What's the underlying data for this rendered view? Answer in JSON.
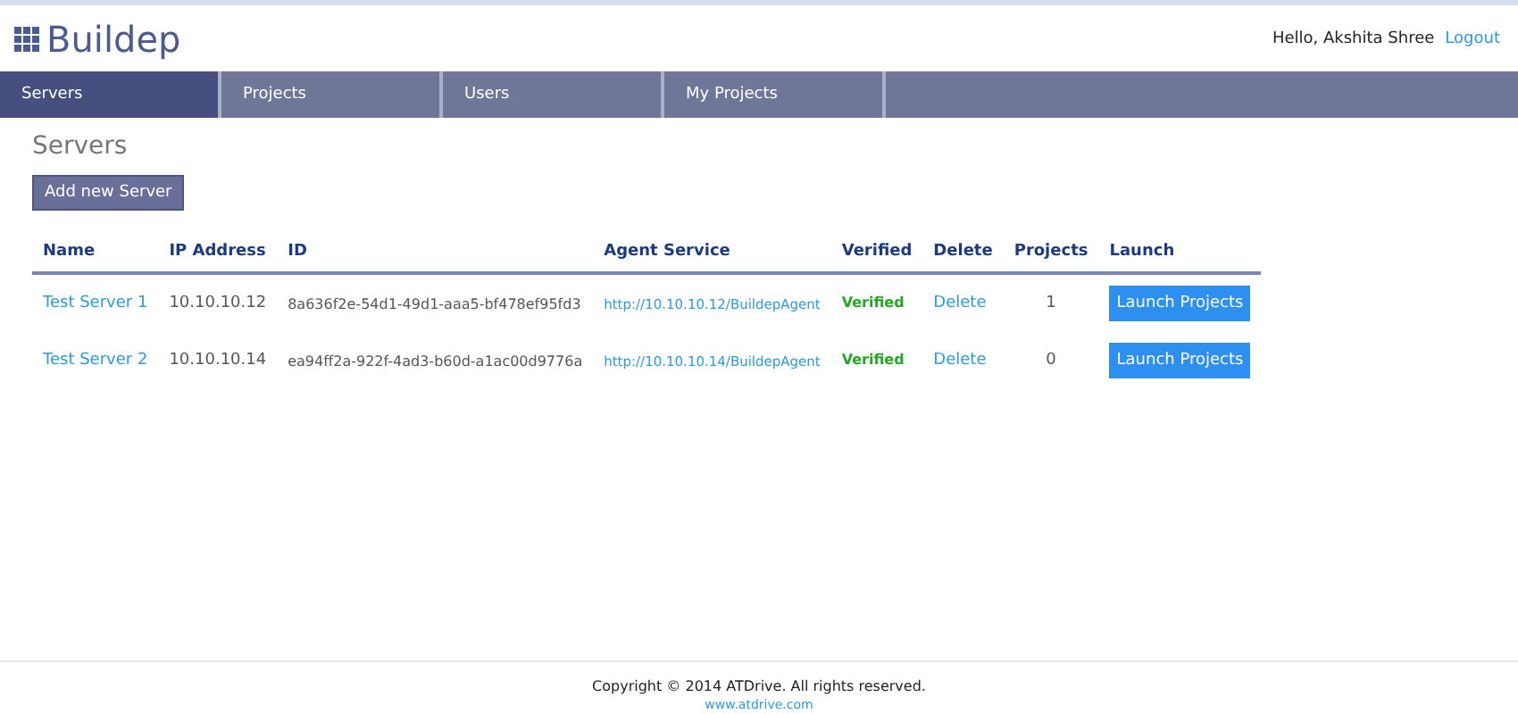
{
  "brand": "Buildep",
  "user": {
    "greeting": "Hello, Akshita Shree",
    "logout": "Logout"
  },
  "nav": [
    {
      "label": "Servers",
      "selected": true
    },
    {
      "label": "Projects",
      "selected": false
    },
    {
      "label": "Users",
      "selected": false
    },
    {
      "label": "My Projects",
      "selected": false
    }
  ],
  "page_title": "Servers",
  "add_button": "Add new Server",
  "table": {
    "columns": [
      "Name",
      "IP Address",
      "ID",
      "Agent Service",
      "Verified",
      "Delete",
      "Projects",
      "Launch"
    ],
    "rows": [
      {
        "name": "Test Server 1",
        "ip": "10.10.10.12",
        "id": "8a636f2e-54d1-49d1-aaa5-bf478ef95fd3",
        "agent": "http://10.10.10.12/BuildepAgent",
        "verified_label": "Verified",
        "verified": true,
        "delete": "Delete",
        "projects": "1",
        "launch": "Launch Projects"
      },
      {
        "name": "Test Server 2",
        "ip": "10.10.10.14",
        "id": "ea94ff2a-922f-4ad3-b60d-a1ac00d9776a",
        "agent": "http://10.10.10.14/BuildepAgent",
        "verified_label": "Verified",
        "verified": true,
        "delete": "Delete",
        "projects": "0",
        "launch": "Launch Projects"
      }
    ]
  },
  "footer": {
    "copyright": "Copyright © 2014 ATDrive. All rights reserved.",
    "link": "www.atdrive.com"
  }
}
